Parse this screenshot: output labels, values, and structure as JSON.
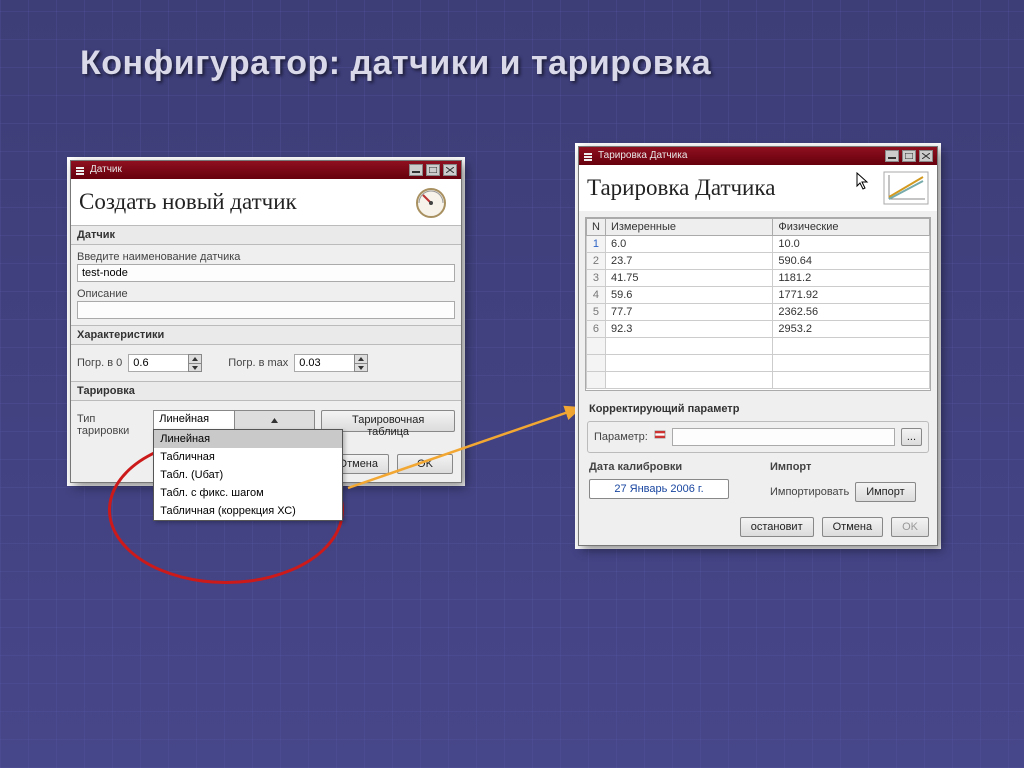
{
  "slide_title": "Конфигуратор: датчики и тарировка",
  "left": {
    "window_title": "Датчик",
    "heading": "Создать новый датчик",
    "group_sensor": "Датчик",
    "name_label": "Введите наименование датчика",
    "name_value": "test-node",
    "desc_label": "Описание",
    "desc_value": "",
    "group_char": "Характеристики",
    "err0_label": "Погр. в 0",
    "err0_value": "0.6",
    "errmax_label": "Погр. в max",
    "errmax_value": "0.03",
    "group_cal": "Тарировка",
    "cal_type_label": "Тип тарировки",
    "cal_type_selected": "Линейная",
    "cal_options": [
      "Линейная",
      "Табличная",
      "Табл. (Uбат)",
      "Табл. с фикс. шагом",
      "Табличная (коррекция ХС)"
    ],
    "cal_table_btn": "Тарировочная таблица",
    "cancel": "Отмена",
    "ok": "OK"
  },
  "right": {
    "window_title": "Тарировка Датчика",
    "heading": "Тарировка Датчика",
    "col_n": "N",
    "col_measured": "Измеренные",
    "col_physical": "Физические",
    "rows": [
      {
        "n": "1",
        "m": "6.0",
        "p": "10.0"
      },
      {
        "n": "2",
        "m": "23.7",
        "p": "590.64"
      },
      {
        "n": "3",
        "m": "41.75",
        "p": "1181.2"
      },
      {
        "n": "4",
        "m": "59.6",
        "p": "1771.92"
      },
      {
        "n": "5",
        "m": "77.7",
        "p": "2362.56"
      },
      {
        "n": "6",
        "m": "92.3",
        "p": "2953.2"
      }
    ],
    "correcting_param": "Корректирующий параметр",
    "param_label": "Параметр:",
    "param_value": "",
    "browse": "...",
    "date_head": "Дата калибровки",
    "date_value": "27 Январь 2006 г.",
    "import_head": "Импорт",
    "import_label": "Импортировать",
    "import_btn": "Импорт",
    "restore": "остановит",
    "cancel": "Отмена",
    "ok": "OK"
  }
}
